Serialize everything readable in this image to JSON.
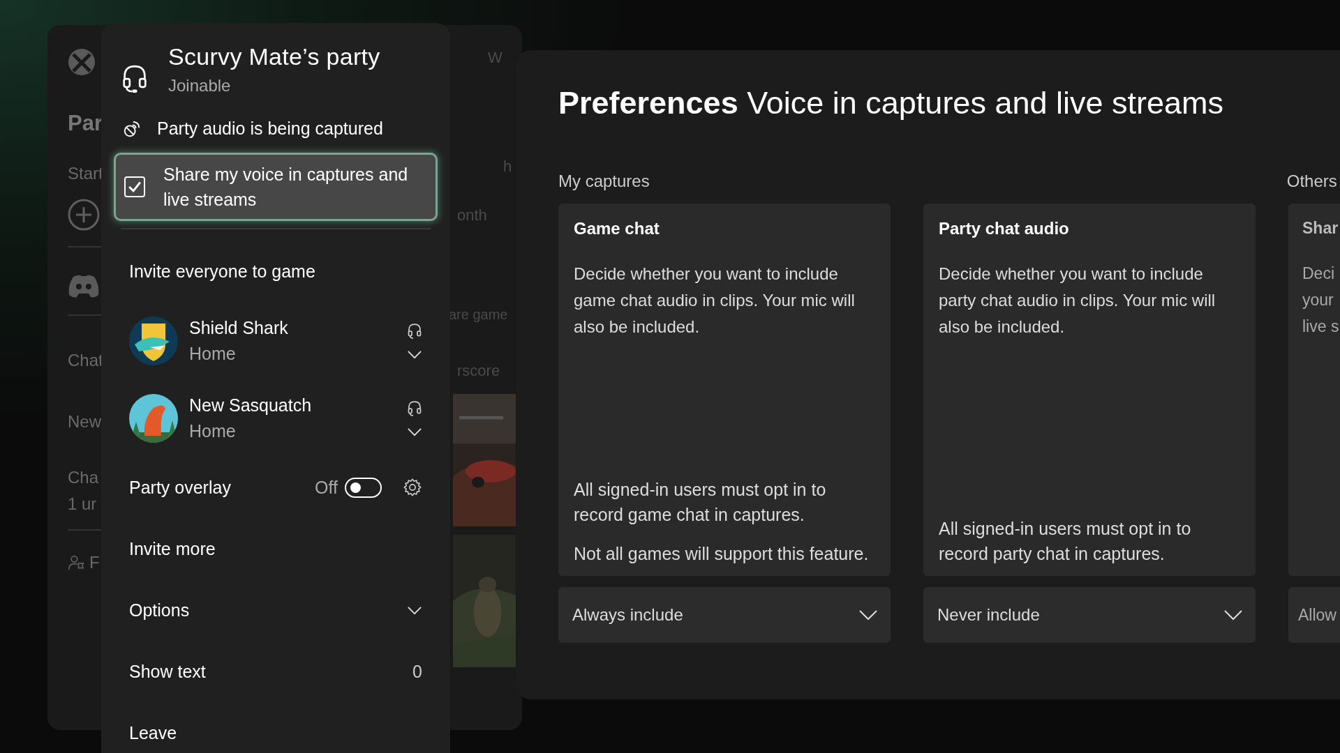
{
  "guide": {
    "heading": "Par",
    "start_label": "Start",
    "chat_label": "Chat",
    "new_label": "New",
    "item_title": "Cha",
    "item_subtitle": "1 ur",
    "footer_label": "F",
    "fragments": [
      "W",
      "h",
      "onth",
      "are game",
      "rscore"
    ]
  },
  "party": {
    "title": "Scurvy Mate’s party",
    "status": "Joinable",
    "capture_notice": "Party audio is being captured",
    "share_voice": {
      "label": "Share my voice in captures and live streams",
      "checked": true
    },
    "invite_everyone": "Invite everyone to game",
    "members": [
      {
        "name": "Shield Shark",
        "status": "Home"
      },
      {
        "name": "New Sasquatch",
        "status": "Home"
      }
    ],
    "overlay": {
      "label": "Party overlay",
      "state_text": "Off",
      "on": false
    },
    "menu": [
      {
        "label": "Invite more",
        "kind": "link"
      },
      {
        "label": "Options",
        "kind": "expander"
      },
      {
        "label": "Show text",
        "kind": "count",
        "value": "0"
      },
      {
        "label": "Leave",
        "kind": "link"
      }
    ]
  },
  "preferences": {
    "title_bold": "Preferences",
    "title": "Voice in captures and live streams",
    "sections": [
      "My captures",
      "Others"
    ],
    "cards": [
      {
        "title": "Game chat",
        "description": "Decide whether you want to include game chat audio in clips. Your mic will also be included.",
        "notes": [
          "All signed-in users must opt in to record game chat in captures.",
          "Not all games will support this feature."
        ],
        "dropdown": "Always include"
      },
      {
        "title": "Party chat audio",
        "description": "Decide whether you want to include party chat audio in clips. Your mic will also be included.",
        "notes": [
          "All signed-in users must opt in to record party chat in captures."
        ],
        "dropdown": "Never include"
      },
      {
        "title": "Shar",
        "description_lines": [
          "Deci",
          "your",
          "live s"
        ],
        "dropdown": "Allow"
      }
    ]
  }
}
